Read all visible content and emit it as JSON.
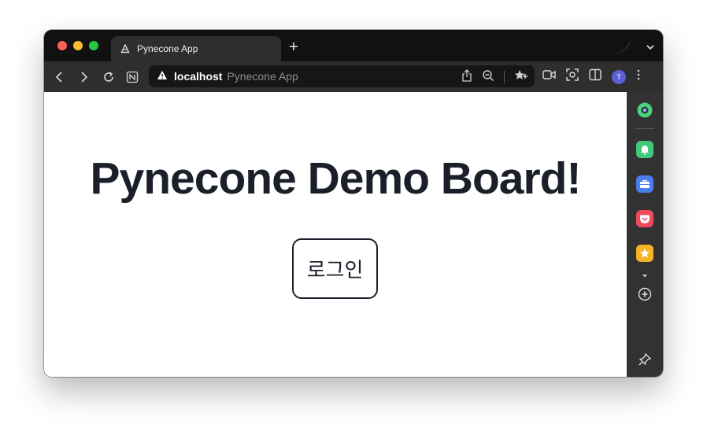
{
  "browser": {
    "tab": {
      "title": "Pynecone App",
      "icon": "pynecone-logo-icon"
    },
    "new_tab_label": "+",
    "address": {
      "host": "localhost",
      "page_title": "Pynecone App"
    },
    "profile_initial": "T"
  },
  "page": {
    "headline": "Pynecone Demo Board!",
    "login_button_label": "로그인"
  },
  "sidebar": {
    "items": [
      {
        "icon": "ring-app-icon",
        "color": "#4cd07d"
      },
      {
        "icon": "bell-app-icon",
        "color": "#3fc97a"
      },
      {
        "icon": "briefcase-app-icon",
        "color": "#4a7dee"
      },
      {
        "icon": "pocket-app-icon",
        "color": "#ef4a5c"
      },
      {
        "icon": "star-app-icon",
        "color": "#f5b425"
      }
    ]
  },
  "colors": {
    "headline": "#1b1f2a",
    "tabstrip": "#111111",
    "toolbar": "#2e2e2e",
    "sidebar": "#323232"
  }
}
